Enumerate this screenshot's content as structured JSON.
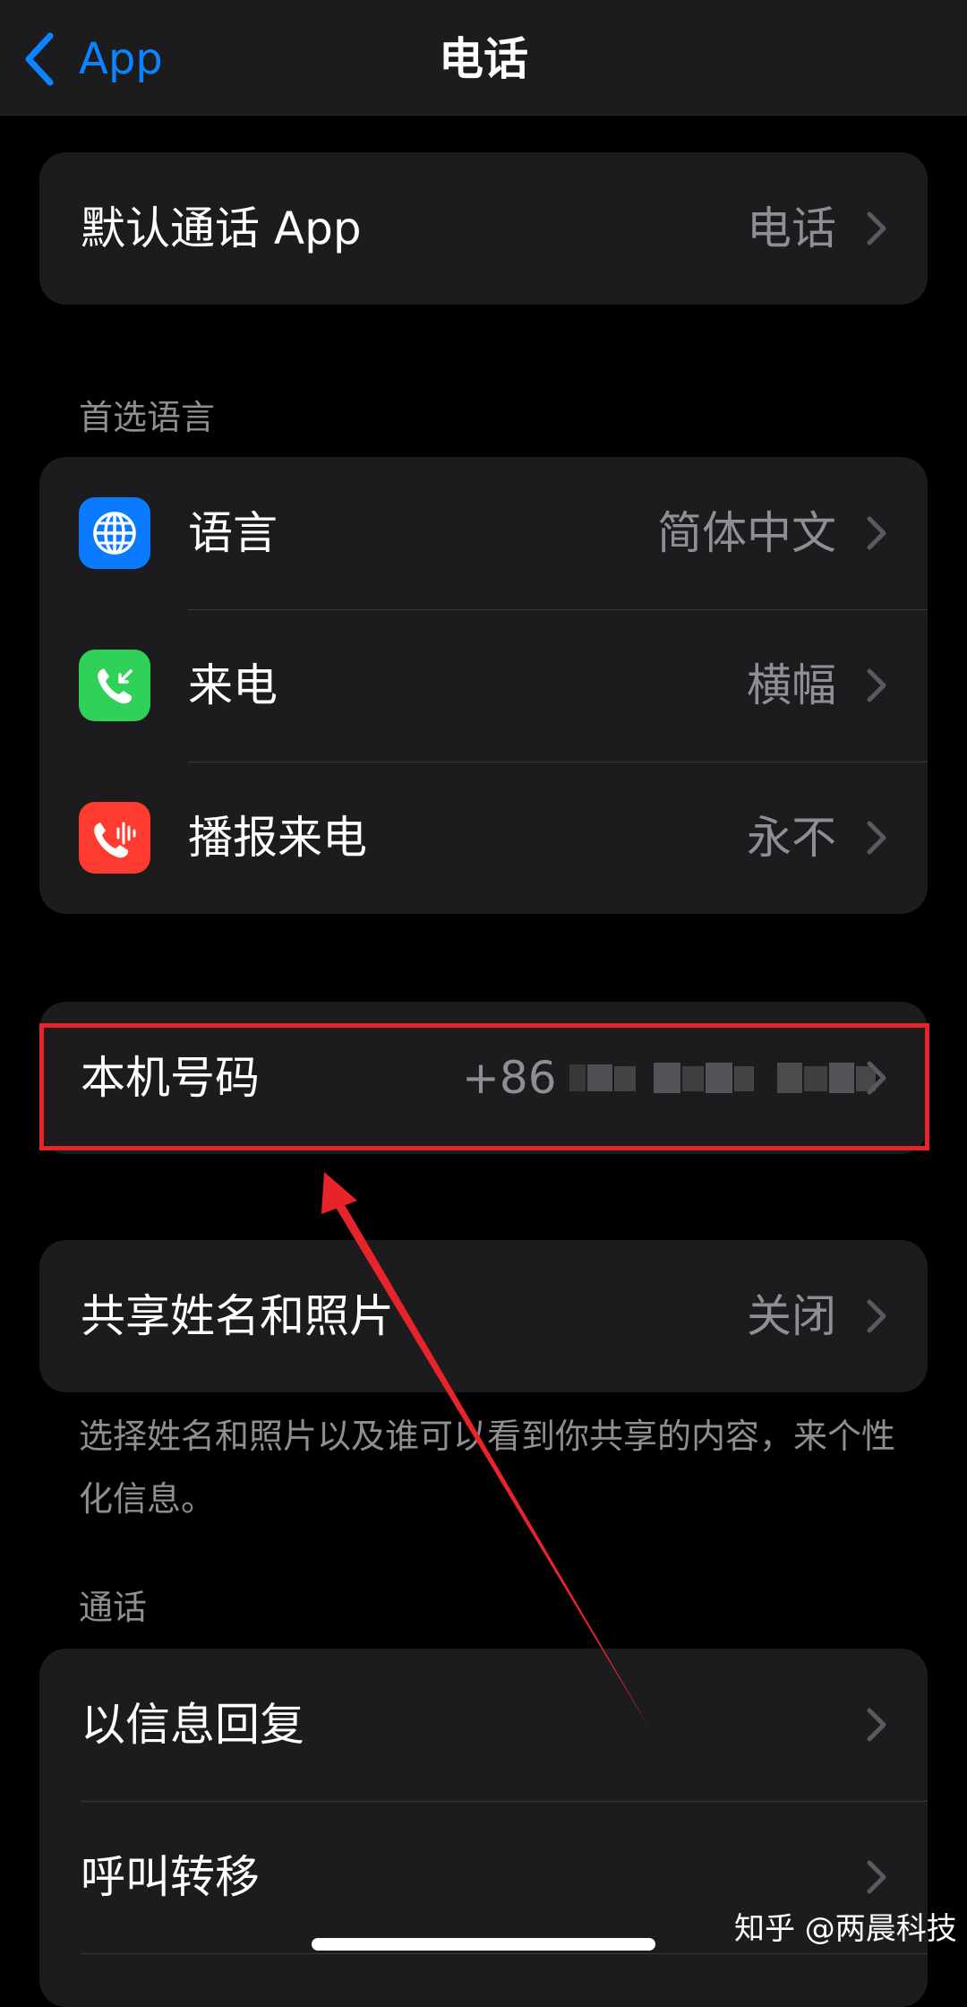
{
  "navbar": {
    "back_label": "App",
    "title": "电话"
  },
  "default_app": {
    "label": "默认通话 App",
    "value": "电话"
  },
  "language_section": {
    "header": "首选语言",
    "items": [
      {
        "label": "语言",
        "value": "简体中文",
        "icon": "globe-icon",
        "icon_color": "#0a7aff"
      },
      {
        "label": "来电",
        "value": "横幅",
        "icon": "incoming-call-icon",
        "icon_color": "#30d158"
      },
      {
        "label": "播报来电",
        "value": "永不",
        "icon": "announce-calls-icon",
        "icon_color": "#ff3b30"
      }
    ]
  },
  "my_number": {
    "label": "本机号码",
    "value_prefix": "+86"
  },
  "share_name": {
    "label": "共享姓名和照片",
    "value": "关闭",
    "footnote": "选择姓名和照片以及谁可以看到你共享的内容，来个性化信息。"
  },
  "calls_section": {
    "header": "通话",
    "items": [
      {
        "label": "以信息回复"
      },
      {
        "label": "呼叫转移"
      }
    ]
  },
  "watermark": "知乎 @两晨科技",
  "colors": {
    "accent": "#0a84ff",
    "annotation": "#e8242b",
    "secondary_text": "#8e8e93",
    "cell_background": "#1c1c1e"
  }
}
